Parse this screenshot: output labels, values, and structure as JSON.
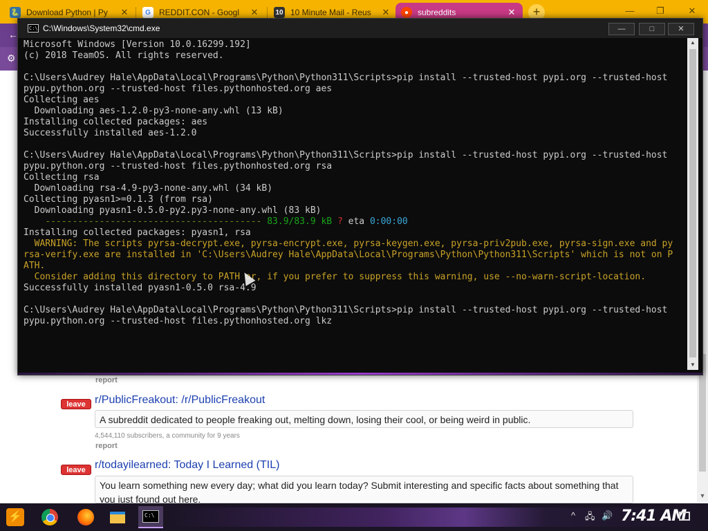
{
  "browser": {
    "tabs": [
      {
        "title": "Download Python | Py",
        "icon": "python-icon",
        "active": false
      },
      {
        "title": "REDDIT.CON - Googl",
        "icon": "google-icon",
        "active": false
      },
      {
        "title": "10 Minute Mail - Reus",
        "icon": "tenminutemail-icon",
        "active": false
      },
      {
        "title": "subreddits",
        "icon": "reddit-icon",
        "active": true
      }
    ],
    "new_tab_label": "+",
    "minimize_label": "—",
    "maximize_label": "❐",
    "close_label": "✕"
  },
  "page": {
    "report_label": "report",
    "leave_label": "leave",
    "subreddits": [
      {
        "title": "r/PublicFreakout: /r/PublicFreakout",
        "description": "A subreddit dedicated to people freaking out, melting down, losing their cool, or being weird in public.",
        "meta": "4,544,110 subscribers, a community for 9 years"
      },
      {
        "title": "r/todayilearned: Today I Learned (TIL)",
        "description": "You learn something new every day; what did you learn today? Submit interesting and specific facts about something that you just found out here."
      }
    ]
  },
  "cmd": {
    "title": "C:\\Windows\\System32\\cmd.exe",
    "min_label": "—",
    "max_label": "□",
    "close_label": "✕",
    "lines": [
      {
        "t": "Microsoft Windows [Version 10.0.16299.192]"
      },
      {
        "t": "(c) 2018 TeamOS. All rights reserved."
      },
      {
        "t": ""
      },
      {
        "t": "C:\\Users\\Audrey Hale\\AppData\\Local\\Programs\\Python\\Python311\\Scripts>pip install --trusted-host pypi.org --trusted-host"
      },
      {
        "t": "pypu.python.org --trusted-host files.pythonhosted.org aes"
      },
      {
        "t": "Collecting aes"
      },
      {
        "t": "  Downloading aes-1.2.0-py3-none-any.whl (13 kB)"
      },
      {
        "t": "Installing collected packages: aes"
      },
      {
        "t": "Successfully installed aes-1.2.0"
      },
      {
        "t": ""
      },
      {
        "t": "C:\\Users\\Audrey Hale\\AppData\\Local\\Programs\\Python\\Python311\\Scripts>pip install --trusted-host pypi.org --trusted-host"
      },
      {
        "t": "pypu.python.org --trusted-host files.pythonhosted.org rsa"
      },
      {
        "t": "Collecting rsa"
      },
      {
        "t": "  Downloading rsa-4.9-py3-none-any.whl (34 kB)"
      },
      {
        "t": "Collecting pyasn1>=0.1.3 (from rsa)"
      },
      {
        "t": "  Downloading pyasn1-0.5.0-py2.py3-none-any.whl (83 kB)"
      },
      {
        "progress": true
      },
      {
        "t": "Installing collected packages: pyasn1, rsa"
      },
      {
        "t": "  WARNING: The scripts pyrsa-decrypt.exe, pyrsa-encrypt.exe, pyrsa-keygen.exe, pyrsa-priv2pub.exe, pyrsa-sign.exe and py",
        "c": "yellow"
      },
      {
        "t": "rsa-verify.exe are installed in 'C:\\Users\\Audrey Hale\\AppData\\Local\\Programs\\Python\\Python311\\Scripts' which is not on P",
        "c": "yellow"
      },
      {
        "t": "ATH.",
        "c": "yellow"
      },
      {
        "t": "  Consider adding this directory to PATH or, if you prefer to suppress this warning, use --no-warn-script-location.",
        "c": "yellow"
      },
      {
        "t": "Successfully installed pyasn1-0.5.0 rsa-4.9"
      },
      {
        "t": ""
      },
      {
        "t": "C:\\Users\\Audrey Hale\\AppData\\Local\\Programs\\Python\\Python311\\Scripts>pip install --trusted-host pypi.org --trusted-host"
      },
      {
        "t": "pypu.python.org --trusted-host files.pythonhosted.org lkz"
      }
    ],
    "progress": {
      "bar": "----------------------------------------",
      "amount": "83.9/83.9 kB",
      "sep": "?",
      "eta_label": "eta",
      "eta": "0:00:00",
      "fraction": 1.0
    }
  },
  "taskbar": {
    "start_icon": "start-orb-icon",
    "apps": [
      "chrome-icon",
      "firefox-icon",
      "file-explorer-icon",
      "cmd-icon"
    ],
    "clock": "7:41 AM",
    "tray_chevron": "^",
    "tray_network": "🖧",
    "tray_volume": "🔊"
  }
}
